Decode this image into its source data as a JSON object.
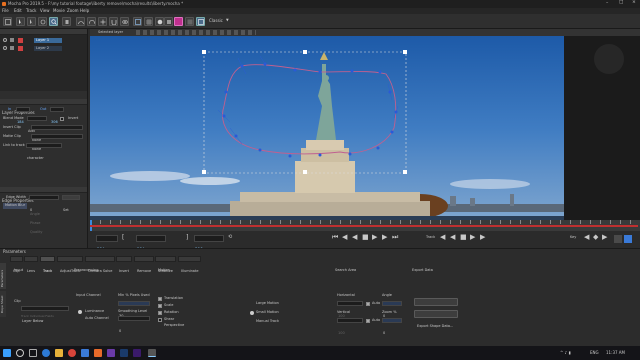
{
  "window": {
    "title": "Mocha Pro 2019.5 - F:\\my tutorial footage\\liberty remove\\mocha\\results\\liberty.mocha *"
  },
  "menu": [
    "File",
    "Edit",
    "Track",
    "View",
    "Movie",
    "Zoom",
    "Help"
  ],
  "toolbar": {
    "layer_dropdown": "Selected layer",
    "view_mode": "Classic"
  },
  "layers_panel": {
    "title": "Layers",
    "layers": [
      {
        "name": "Layer 1",
        "selected": true
      },
      {
        "name": "Layer 2",
        "selected": false
      }
    ]
  },
  "layer_properties": {
    "title": "Layer Properties",
    "in_label": "In",
    "in_value": "184",
    "out_label": "Out",
    "out_value": "306",
    "blend_mode_label": "Blend Mode",
    "blend_mode_value": "Add",
    "invert_label": "Invert",
    "insert_clip_label": "Insert Clip",
    "insert_clip_value": "None",
    "matte_clip_label": "Matte Clip",
    "matte_clip_value": "None",
    "link_track_label": "Link to track",
    "link_track_value": "character"
  },
  "edge_properties": {
    "title": "Edge Properties",
    "edge_width_label": "Edge Width",
    "edge_width_value": "0",
    "set_label": "Set",
    "motion_blur_label": "Motion Blur",
    "angle_label": "Angle",
    "phase_label": "Phase",
    "quality_label": "Quality"
  },
  "timeline": {
    "start_frame": "184",
    "current_frame": "184",
    "end_frame": "306",
    "track_label": "Track",
    "key_label": "Key"
  },
  "parameters": {
    "title": "Parameters",
    "tabs": [
      "Clip",
      "Lens",
      "Track",
      "AdjustTrack",
      "Camera Solve",
      "Insert",
      "Remove",
      "Stabilize",
      "Illuminate"
    ],
    "active_tab": "Track",
    "side_tabs": [
      "Parameters",
      "Dope Sheet"
    ],
    "input_label": "Input",
    "preprocessing_label": "Preprocessing",
    "motion_label": "Motion",
    "search_area_label": "Search Area",
    "export_data_label": "Export Data",
    "clip_label": "Clip",
    "clip_value": "Layer Below",
    "track_individual_label": "Track Individual Fields",
    "input_channel_label": "Input Channel",
    "luminance_label": "Luminance",
    "auto_channel_label": "Auto Channel",
    "min_pixels_label": "Min % Pixels Used",
    "min_pixels_value": "30",
    "smoothing_label": "Smoothing Level",
    "smoothing_value": "0",
    "translation_label": "Translation",
    "scale_label": "Scale",
    "rotation_label": "Rotation",
    "shear_label": "Shear",
    "perspective_label": "Perspective",
    "large_motion_label": "Large Motion",
    "small_motion_label": "Small Motion",
    "manual_track_label": "Manual Track",
    "horizontal_label": "Horizontal",
    "horizontal_value": "100",
    "horizontal_auto": "Auto",
    "vertical_label": "Vertical",
    "vertical_value": "100",
    "vertical_auto": "Auto",
    "angle_label": "Angle",
    "angle_value": "0",
    "zoom_label": "Zoom %",
    "zoom_value": "0",
    "export_tracking_button": "Export Tracking Data...",
    "export_shape_button": "Export Shape Data..."
  },
  "taskbar": {
    "time": "11:37 AM",
    "lang": "ENG"
  }
}
